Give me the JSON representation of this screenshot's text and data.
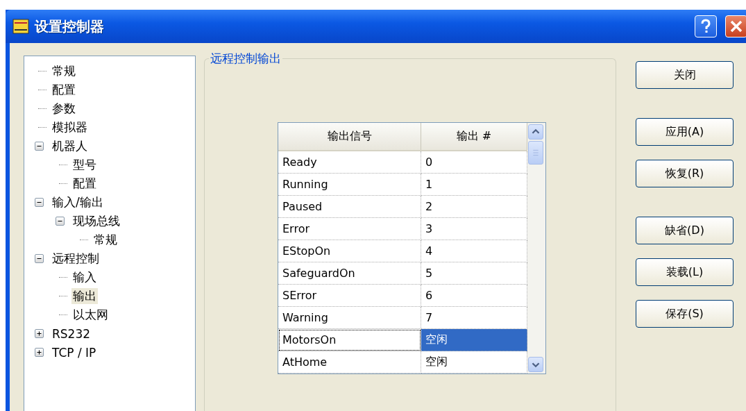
{
  "window": {
    "title": "设置控制器"
  },
  "tree": [
    {
      "label": "常规",
      "selected": false
    },
    {
      "label": "配置",
      "selected": false
    },
    {
      "label": "参数",
      "selected": false
    },
    {
      "label": "模拟器",
      "selected": false
    },
    {
      "label": "机器人",
      "selected": false,
      "expanded": true,
      "children": [
        {
          "label": "型号",
          "selected": false
        },
        {
          "label": "配置",
          "selected": false
        }
      ]
    },
    {
      "label": "输入/输出",
      "selected": false,
      "expanded": true,
      "children": [
        {
          "label": "现场总线",
          "selected": false,
          "expanded": true,
          "children": [
            {
              "label": "常规",
              "selected": false
            }
          ]
        }
      ]
    },
    {
      "label": "远程控制",
      "selected": false,
      "expanded": true,
      "children": [
        {
          "label": "输入",
          "selected": false
        },
        {
          "label": "输出",
          "selected": true
        },
        {
          "label": "以太网",
          "selected": false
        }
      ]
    },
    {
      "label": "RS232",
      "selected": false,
      "expanded": false
    },
    {
      "label": "TCP / IP",
      "selected": false,
      "expanded": false
    }
  ],
  "group": {
    "title": "远程控制输出"
  },
  "table": {
    "columns": [
      "输出信号",
      "输出 #"
    ],
    "rows": [
      {
        "signal": "Ready",
        "output": "0",
        "selected": false
      },
      {
        "signal": "Running",
        "output": "1",
        "selected": false
      },
      {
        "signal": "Paused",
        "output": "2",
        "selected": false
      },
      {
        "signal": "Error",
        "output": "3",
        "selected": false
      },
      {
        "signal": "EStopOn",
        "output": "4",
        "selected": false
      },
      {
        "signal": "SafeguardOn",
        "output": "5",
        "selected": false
      },
      {
        "signal": "SError",
        "output": "6",
        "selected": false
      },
      {
        "signal": "Warning",
        "output": "7",
        "selected": false
      },
      {
        "signal": "MotorsOn",
        "output": "空闲",
        "selected": true
      },
      {
        "signal": "AtHome",
        "output": "空闲",
        "selected": false
      }
    ]
  },
  "buttons": [
    "关闭",
    "应用(A)",
    "恢复(R)",
    "缺省(D)",
    "装载(L)",
    "保存(S)"
  ]
}
